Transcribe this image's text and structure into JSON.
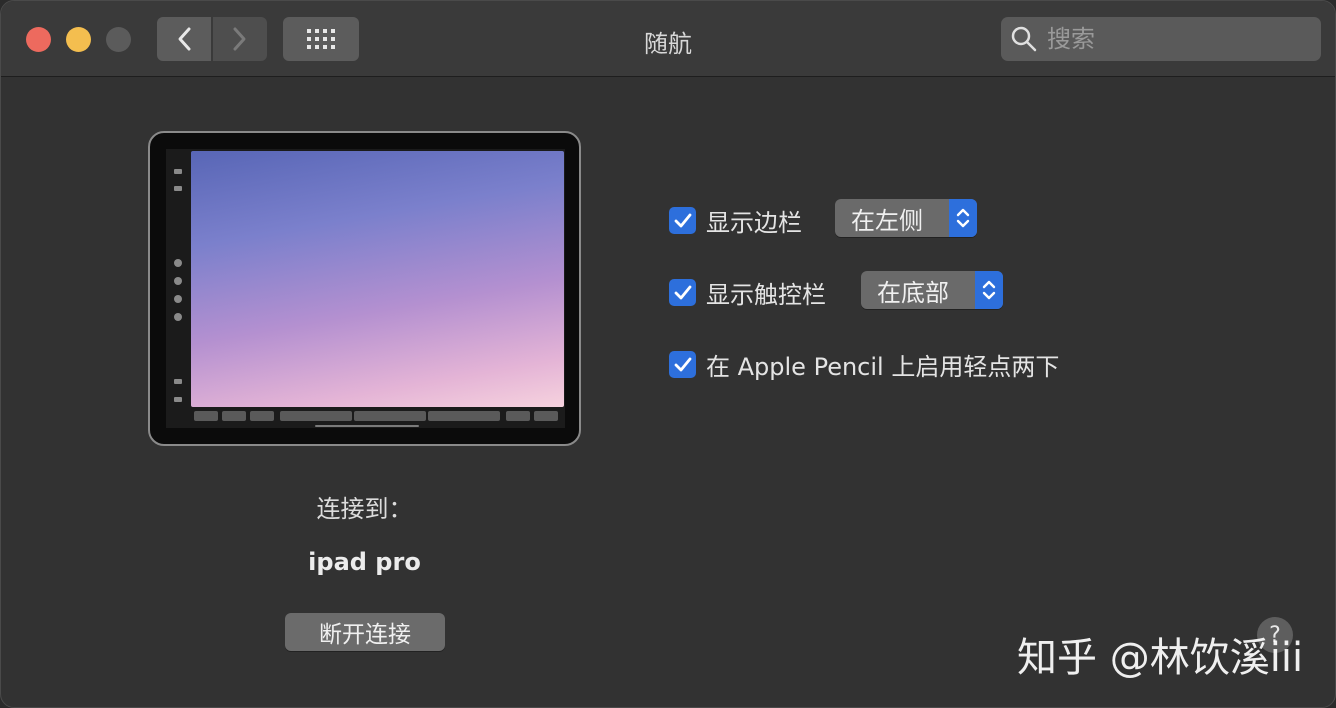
{
  "window": {
    "title": "随航",
    "controls": [
      "close",
      "minimize",
      "maximize"
    ]
  },
  "toolbar": {
    "back_icon": "chevron-left-icon",
    "forward_icon": "chevron-right-icon",
    "show_all_icon": "grid-icon"
  },
  "search": {
    "placeholder": "搜索",
    "icon": "search-icon"
  },
  "device_preview": {
    "connect_label": "连接到：",
    "device_name": "ipad pro",
    "disconnect_label": "断开连接"
  },
  "options": [
    {
      "label": "显示边栏",
      "checked": true,
      "popup_value": "在左侧"
    },
    {
      "label": "显示触控栏",
      "checked": true,
      "popup_value": "在底部"
    },
    {
      "label": "在 Apple Pencil 上启用轻点两下",
      "checked": true
    }
  ],
  "help": {
    "label": "?"
  },
  "watermark": {
    "text": "知乎 @林饮溪iii"
  },
  "colors": {
    "accent": "#2d6fdc",
    "close": "#ed6a5e",
    "minimize": "#f4be4f",
    "maximize": "#5b5b5b"
  }
}
